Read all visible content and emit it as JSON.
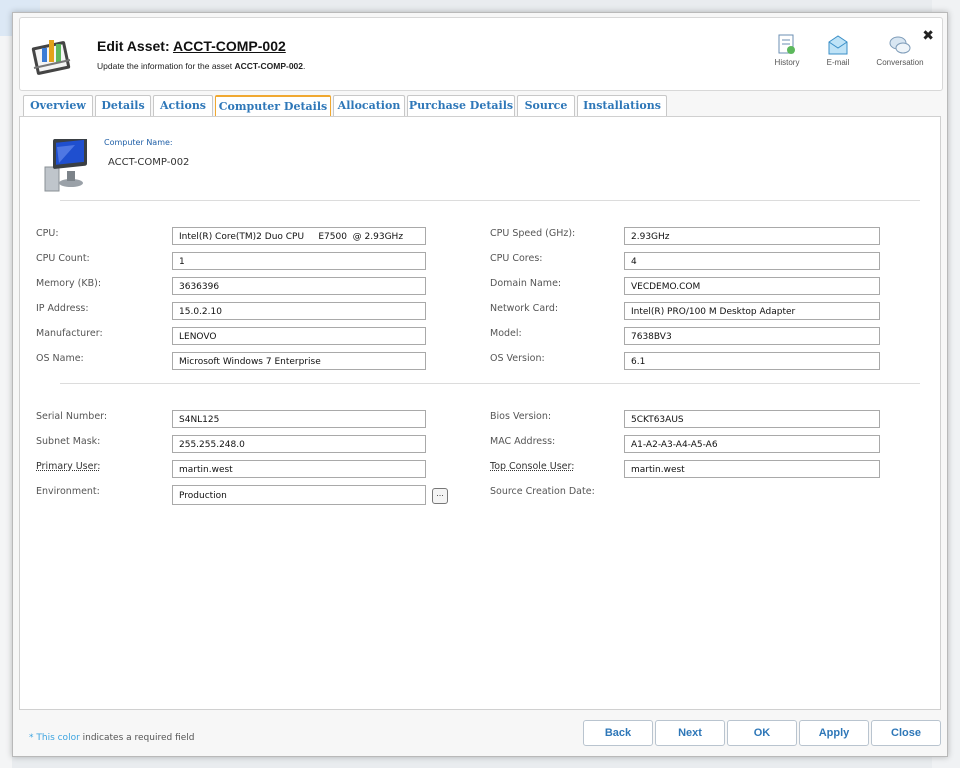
{
  "header": {
    "title_prefix": "Edit Asset:",
    "asset_name": "ACCT-COMP-002",
    "subtitle_prefix": "Update the information for the asset",
    "subtitle_asset": "ACCT-COMP-002",
    "subtitle_suffix": ".",
    "buttons": {
      "history": "History",
      "email": "E-mail",
      "conversation": "Conversation"
    },
    "close": "✖"
  },
  "tabs": [
    "Overview",
    "Details",
    "Actions",
    "Computer Details",
    "Allocation",
    "Purchase Details",
    "Source",
    "Installations"
  ],
  "active_tab": "Computer Details",
  "computer": {
    "name_label": "Computer Name:",
    "name_value": "ACCT-COMP-002"
  },
  "fields": {
    "cpu": {
      "label": "CPU:",
      "value": "Intel(R) Core(TM)2 Duo CPU     E7500  @ 2.93GHz"
    },
    "cpu_speed": {
      "label": "CPU Speed (GHz):",
      "value": "2.93GHz"
    },
    "cpu_count": {
      "label": "CPU Count:",
      "value": "1"
    },
    "cpu_cores": {
      "label": "CPU Cores:",
      "value": "4"
    },
    "memory": {
      "label": "Memory (KB):",
      "value": "3636396"
    },
    "domain": {
      "label": "Domain Name:",
      "value": "VECDEMO.COM"
    },
    "ip": {
      "label": "IP Address:",
      "value": "15.0.2.10"
    },
    "network_card": {
      "label": "Network Card:",
      "value": "Intel(R) PRO/100 M Desktop Adapter"
    },
    "manufacturer": {
      "label": "Manufacturer:",
      "value": "LENOVO"
    },
    "model": {
      "label": "Model:",
      "value": "7638BV3"
    },
    "os_name": {
      "label": "OS Name:",
      "value": "Microsoft Windows 7 Enterprise"
    },
    "os_version": {
      "label": "OS Version:",
      "value": "6.1"
    },
    "serial": {
      "label": "Serial Number:",
      "value": "S4NL125"
    },
    "bios": {
      "label": "Bios Version:",
      "value": "5CKT63AUS"
    },
    "subnet": {
      "label": "Subnet Mask:",
      "value": "255.255.248.0"
    },
    "mac": {
      "label": "MAC Address:",
      "value": "A1-A2-A3-A4-A5-A6"
    },
    "primary_user": {
      "label": "Primary User:",
      "value": "martin.west"
    },
    "top_console_user": {
      "label": "Top Console User:",
      "value": "martin.west"
    },
    "environment": {
      "label": "Environment:",
      "value": "Production",
      "browse": "..."
    },
    "source_creation_date": {
      "label": "Source Creation Date:"
    }
  },
  "footer": {
    "required_color_text": "* This color",
    "required_rest": " indicates a required field",
    "buttons": {
      "back": "Back",
      "next": "Next",
      "ok": "OK",
      "apply": "Apply",
      "close": "Close"
    }
  },
  "colors": {
    "accent": "#2e77b8",
    "active_tab": "#f0a830",
    "required": "#3da4e0"
  }
}
